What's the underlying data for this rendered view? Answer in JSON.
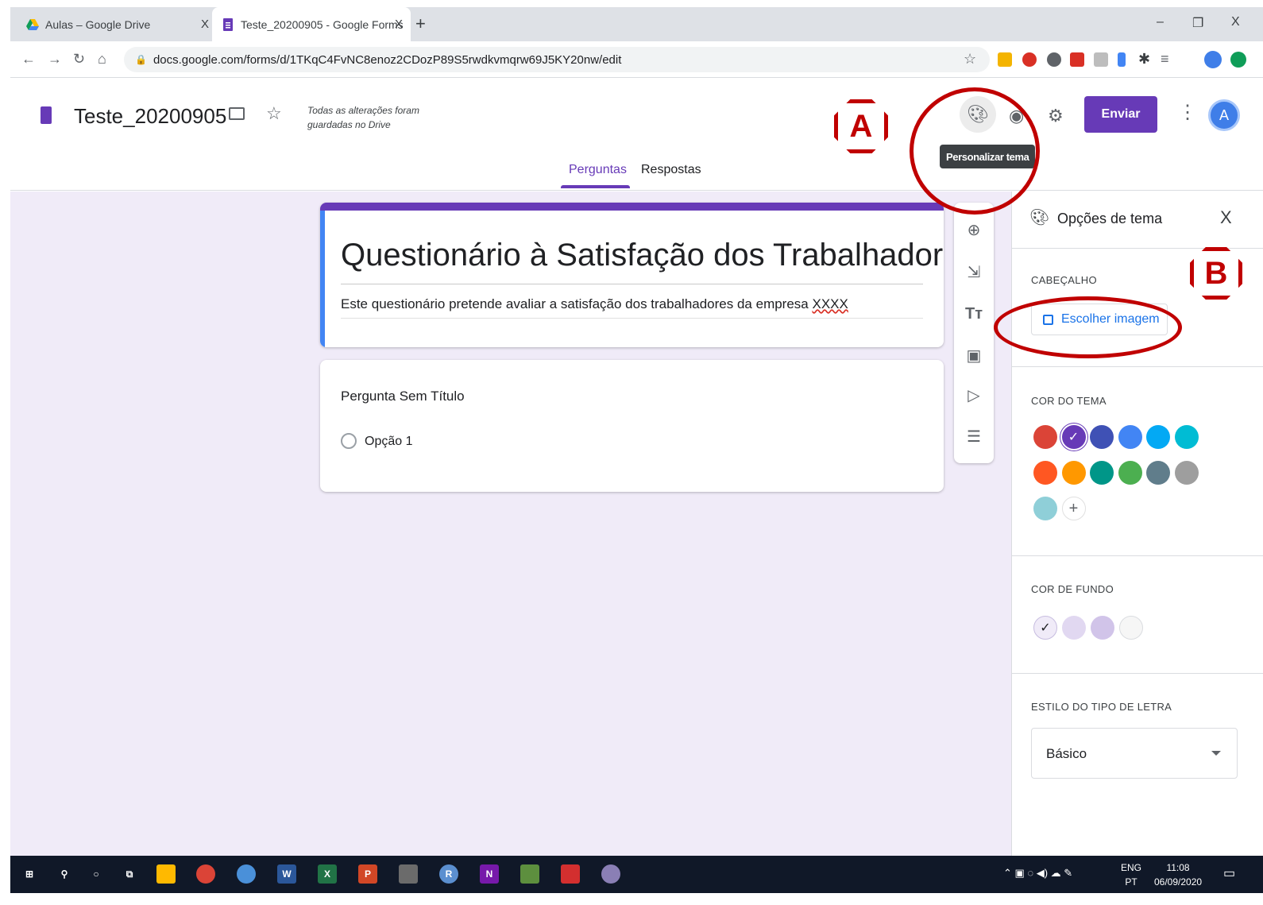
{
  "browser": {
    "tabs": [
      {
        "title": "Aulas – Google Drive",
        "close": "X"
      },
      {
        "title": "Teste_20200905 - Google Forms",
        "close": "X"
      }
    ],
    "new_tab": "+",
    "window_controls": {
      "minimize": "–",
      "restore": "❐",
      "close": "X"
    },
    "url": "docs.google.com/forms/d/1TKqC4FvNC8enoz2CDozP89S5rwdkvmqrw69J5KY20nw/edit"
  },
  "header": {
    "doc_title": "Teste_20200905",
    "saved_note_line1": "Todas as alterações foram",
    "saved_note_line2": "guardadas no Drive",
    "send_label": "Enviar",
    "avatar_letter": "A",
    "tooltip": "Personalizar tema",
    "tabs": {
      "questions": "Perguntas",
      "responses": "Respostas"
    }
  },
  "form": {
    "title": "Questionário à Satisfação dos Trabalhadores",
    "description_prefix": "Este questionário pretende avaliar a satisfação dos trabalhadores da empresa ",
    "description_flagged": "XXXX",
    "question_title": "Pergunta Sem Título",
    "option_1": "Opção 1"
  },
  "theme_panel": {
    "title": "Opções de tema",
    "close": "X",
    "header_section": "CABEÇALHO",
    "choose_image": "Escolher imagem",
    "theme_color_section": "COR DO TEMA",
    "theme_colors": [
      "#db4437",
      "#673ab7",
      "#3f51b5",
      "#4285f4",
      "#03a9f4",
      "#00bcd4",
      "#ff5722",
      "#ff9800",
      "#009688",
      "#4caf50",
      "#607d8b",
      "#9e9e9e",
      "#8fcfd8"
    ],
    "selected_theme_color": "#673ab7",
    "background_section": "COR DE FUNDO",
    "background_colors": [
      "#f0ebf8",
      "#e1d8f1",
      "#d1c4e9",
      "#f6f6f6"
    ],
    "font_section": "ESTILO DO TIPO DE LETRA",
    "font_value": "Básico"
  },
  "annotations": {
    "a": "A",
    "b": "B"
  },
  "taskbar": {
    "language": "ENG",
    "layout": "PT",
    "time": "11:08",
    "date": "06/09/2020"
  }
}
